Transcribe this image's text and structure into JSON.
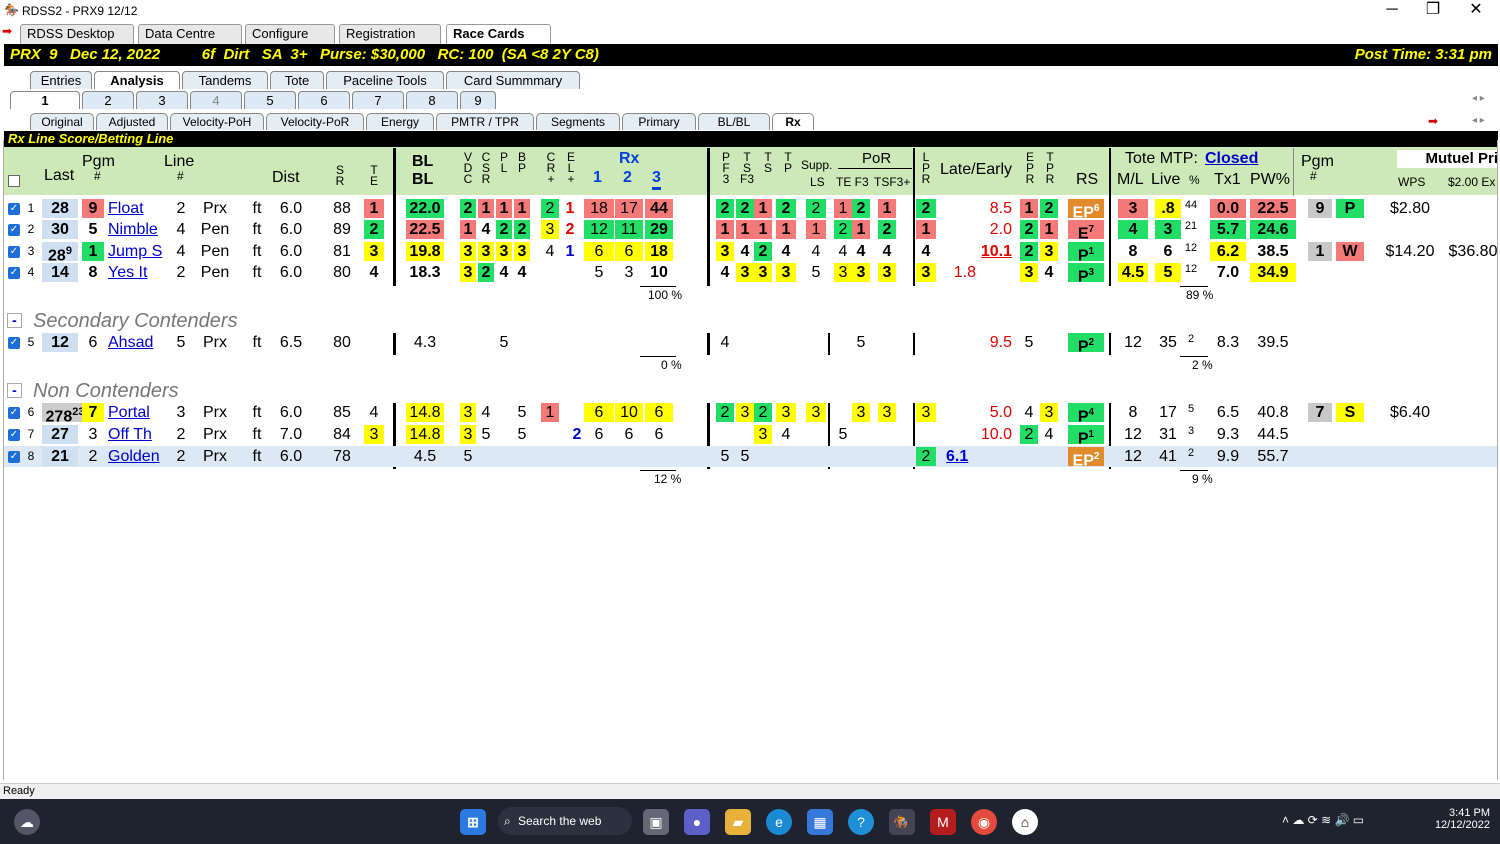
{
  "window": {
    "title": "RDSS2 - PRX9  12/12",
    "min": "─",
    "max": "❐",
    "close": "✕"
  },
  "app_tabs": [
    "RDSS Desktop",
    "Data Centre",
    "Configure",
    "Registration",
    "Race Cards"
  ],
  "race": {
    "left": "PRX  9   Dec 12, 2022          6f  Dirt   SA  3+   Purse: $30,000   RC: 100  (SA <8 2Y C8)",
    "right": "Post Time: 3:31 pm"
  },
  "view_tabs": [
    "Entries",
    "Analysis",
    "Tandems",
    "Tote",
    "Paceline Tools",
    "Card Summmary"
  ],
  "race_tabs": [
    "1",
    "2",
    "3",
    "4",
    "5",
    "6",
    "7",
    "8",
    "9"
  ],
  "analysis_tabs": [
    "Original",
    "Adjusted",
    "Velocity-PoH",
    "Velocity-PoR",
    "Energy",
    "PMTR / TPR",
    "Segments",
    "Primary",
    "BL/BL",
    "Rx"
  ],
  "section_title": "Rx Line Score/Betting Line",
  "headers": {
    "last": "Last",
    "pgm": "Pgm",
    "pgm_hash": "#",
    "line": "Line",
    "line_hash": "#",
    "dist": "Dist",
    "sr": "S\nR",
    "te": "T\nE",
    "blbl1": "BL",
    "blbl2": "BL",
    "vdc": "V\nD\nC",
    "csr": "C\nS\nR",
    "pl": "P\nL",
    "bp": "B\nP",
    "cr": "C\nR\n+",
    "el": "E\nL\n+",
    "rx": "Rx",
    "rx1": "1",
    "rx2": "2",
    "rx3": "3",
    "pf3": "P\nF\n3",
    "tsf3": "T\nS\nF3",
    "ts": "T\nS",
    "tp": "T\nP",
    "supp": "Supp.",
    "ls": "LS",
    "por": "PoR",
    "tef3": "TE F3",
    "tsf3b": "TSF3+",
    "lpr": "L\nP\nR",
    "late": "Late/Early",
    "epr": "E\nP\nR",
    "tpr": "T\nP\nR",
    "rs": "RS",
    "tote": "Tote MTP:",
    "closed": "Closed",
    "ml": "M/L",
    "live": "Live",
    "pctsym": "%",
    "tx1": "Tx1",
    "pw": "PW%",
    "pgm2": "Pgm",
    "pgm2_hash": "#",
    "mutuel": "Mutuel Pri",
    "wps": "WPS",
    "ex": "$2.00 Ex"
  },
  "rows": [
    {
      "n": "1",
      "last": "28",
      "pgm": "9",
      "name": "Float",
      "line": "2",
      "trk": "Prx",
      "surf": "ft",
      "dist": "6.0",
      "sr": "88",
      "te": "1",
      "bl": "22.0",
      "v": "2",
      "c": "1",
      "p": "1",
      "b": "1",
      "cr": "2",
      "el": "1",
      "rx1": "18",
      "rx2": "17",
      "rx3": "44",
      "pf": "2",
      "tsf": "2",
      "ts": "1",
      "tp": "2",
      "ls": "2",
      "te2": "1",
      "f3": "2",
      "tsf3": "1",
      "lpr": "2",
      "early": "",
      "late": "8.5",
      "epr": "1",
      "tpr": "2",
      "rs": "EP",
      "rsn": "6",
      "ml": "3",
      "live": ".8",
      "pc": "44",
      "tx1": "0.0",
      "pw": "22.5",
      "pg2": "9",
      "fin": "P",
      "wps": "$2.80",
      "ex": ""
    },
    {
      "n": "2",
      "last": "30",
      "pgm": "5",
      "name": "Nimble",
      "line": "4",
      "trk": "Pen",
      "surf": "ft",
      "dist": "6.0",
      "sr": "89",
      "te": "2",
      "bl": "22.5",
      "v": "1",
      "c": "4",
      "p": "2",
      "b": "2",
      "cr": "3",
      "el": "2",
      "rx1": "12",
      "rx2": "11",
      "rx3": "29",
      "pf": "1",
      "tsf": "1",
      "ts": "1",
      "tp": "1",
      "ls": "1",
      "te2": "2",
      "f3": "1",
      "tsf3": "2",
      "lpr": "1",
      "early": "",
      "late": "2.0",
      "epr": "2",
      "tpr": "1",
      "rs": "E",
      "rsn": "7",
      "ml": "4",
      "live": "3",
      "pc": "21",
      "tx1": "5.7",
      "pw": "24.6",
      "pg2": "",
      "fin": "",
      "wps": "",
      "ex": ""
    },
    {
      "n": "3",
      "last": "28",
      "lastsup": "9",
      "pgm": "1",
      "name": "Jump S",
      "line": "4",
      "trk": "Pen",
      "surf": "ft",
      "dist": "6.0",
      "sr": "81",
      "te": "3",
      "bl": "19.8",
      "v": "3",
      "c": "3",
      "p": "3",
      "b": "3",
      "cr": "4",
      "el": "1",
      "rx1": "6",
      "rx2": "6",
      "rx3": "18",
      "pf": "3",
      "tsf": "4",
      "ts": "2",
      "tp": "4",
      "ls": "4",
      "te2": "4",
      "f3": "4",
      "tsf3": "4",
      "lpr": "4",
      "early": "",
      "late": "10.1",
      "epr": "2",
      "tpr": "3",
      "rs": "P",
      "rsn": "1",
      "ml": "8",
      "live": "6",
      "pc": "12",
      "tx1": "6.2",
      "pw": "38.5",
      "pg2": "1",
      "fin": "W",
      "wps": "$14.20",
      "ex": "$36.80"
    },
    {
      "n": "4",
      "last": "14",
      "pgm": "8",
      "name": "Yes It",
      "line": "2",
      "trk": "Pen",
      "surf": "ft",
      "dist": "6.0",
      "sr": "80",
      "te": "4",
      "bl": "18.3",
      "v": "3",
      "c": "2",
      "p": "4",
      "b": "4",
      "cr": "",
      "el": "",
      "rx1": "5",
      "rx2": "3",
      "rx3": "10",
      "pf": "4",
      "tsf": "3",
      "ts": "3",
      "tp": "3",
      "ls": "5",
      "te2": "3",
      "f3": "3",
      "tsf3": "3",
      "lpr": "3",
      "early": "1.8",
      "late": "",
      "epr": "3",
      "tpr": "4",
      "rs": "P",
      "rsn": "3",
      "ml": "4.5",
      "live": "5",
      "pc": "12",
      "tx1": "7.0",
      "pw": "34.9",
      "pg2": "",
      "fin": "",
      "wps": "",
      "ex": ""
    },
    {
      "n": "5",
      "last": "12",
      "pgm": "6",
      "name": "Ahsad",
      "line": "5",
      "trk": "Prx",
      "surf": "ft",
      "dist": "6.5",
      "sr": "80",
      "te": "",
      "bl": "4.3",
      "v": "",
      "c": "",
      "p": "5",
      "b": "",
      "cr": "",
      "el": "",
      "rx1": "",
      "rx2": "",
      "rx3": "",
      "pf": "4",
      "tsf": "",
      "ts": "",
      "tp": "",
      "ls": "",
      "te2": "",
      "f3": "5",
      "tsf3": "",
      "lpr": "",
      "early": "",
      "late": "9.5",
      "epr": "5",
      "tpr": "",
      "rs": "P",
      "rsn": "2",
      "ml": "12",
      "live": "35",
      "pc": "2",
      "tx1": "8.3",
      "pw": "39.5",
      "pg2": "",
      "fin": "",
      "wps": "",
      "ex": ""
    },
    {
      "n": "6",
      "last": "278",
      "lastsup": "23",
      "pgm": "7",
      "name": "Portal",
      "line": "3",
      "trk": "Prx",
      "surf": "ft",
      "dist": "6.0",
      "sr": "85",
      "te": "4",
      "bl": "14.8",
      "v": "3",
      "c": "4",
      "p": "",
      "b": "5",
      "cr": "1",
      "el": "",
      "rx1": "6",
      "rx2": "10",
      "rx3": "6",
      "pf": "2",
      "tsf": "3",
      "ts": "2",
      "tp": "3",
      "ls": "3",
      "te2": "",
      "f3": "3",
      "tsf3": "3",
      "lpr": "3",
      "early": "",
      "late": "5.0",
      "epr": "4",
      "tpr": "3",
      "rs": "P",
      "rsn": "4",
      "ml": "8",
      "live": "17",
      "pc": "5",
      "tx1": "6.5",
      "pw": "40.8",
      "pg2": "7",
      "fin": "S",
      "wps": "$6.40",
      "ex": ""
    },
    {
      "n": "7",
      "last": "27",
      "pgm": "3",
      "name": "Off Th",
      "line": "2",
      "trk": "Prx",
      "surf": "ft",
      "dist": "7.0",
      "sr": "84",
      "te": "3",
      "bl": "14.8",
      "v": "3",
      "c": "5",
      "p": "",
      "b": "5",
      "cr": "2",
      "el": "",
      "rx1": "6",
      "rx2": "6",
      "rx3": "6",
      "pf": "",
      "tsf": "",
      "ts": "3",
      "tp": "4",
      "ls": "",
      "te2": "5",
      "f3": "",
      "tsf3": "",
      "lpr": "",
      "early": "",
      "late": "10.0",
      "epr": "2",
      "tpr": "4",
      "rs": "P",
      "rsn": "1",
      "ml": "12",
      "live": "31",
      "pc": "3",
      "tx1": "9.3",
      "pw": "44.5",
      "pg2": "",
      "fin": "",
      "wps": "",
      "ex": ""
    },
    {
      "n": "8",
      "last": "21",
      "pgm": "2",
      "name": "Golden",
      "line": "2",
      "trk": "Prx",
      "surf": "ft",
      "dist": "6.0",
      "sr": "78",
      "te": "",
      "bl": "4.5",
      "v": "5",
      "c": "",
      "p": "",
      "b": "",
      "cr": "",
      "el": "",
      "rx1": "",
      "rx2": "",
      "rx3": "",
      "pf": "5",
      "tsf": "5",
      "ts": "",
      "tp": "",
      "ls": "",
      "te2": "",
      "f3": "",
      "tsf3": "",
      "lpr": "2",
      "early": "6.1",
      "late": "",
      "epr": "",
      "tpr": "",
      "rs": "EP",
      "rsn": "2",
      "ml": "12",
      "live": "41",
      "pc": "2",
      "tx1": "9.9",
      "pw": "55.7",
      "pg2": "",
      "fin": "",
      "wps": "",
      "ex": ""
    }
  ],
  "groups": {
    "secondary": "Secondary Contenders",
    "non": "Non Contenders"
  },
  "pcts": {
    "rx_main": "100 %",
    "tote_main": "89 %",
    "rx_sec": "0 %",
    "tote_sec": "2 %",
    "rx_non": "12 %",
    "tote_non": "9 %"
  },
  "status": "Ready",
  "taskbar": {
    "search": "Search the web",
    "time": "3:41 PM",
    "date": "12/12/2022"
  },
  "colors": {
    "yellow": "#ffff00",
    "green": "#22dd66",
    "red": "#f47a7a",
    "orange": "#e08a2c",
    "header_green": "#cde9b8"
  }
}
